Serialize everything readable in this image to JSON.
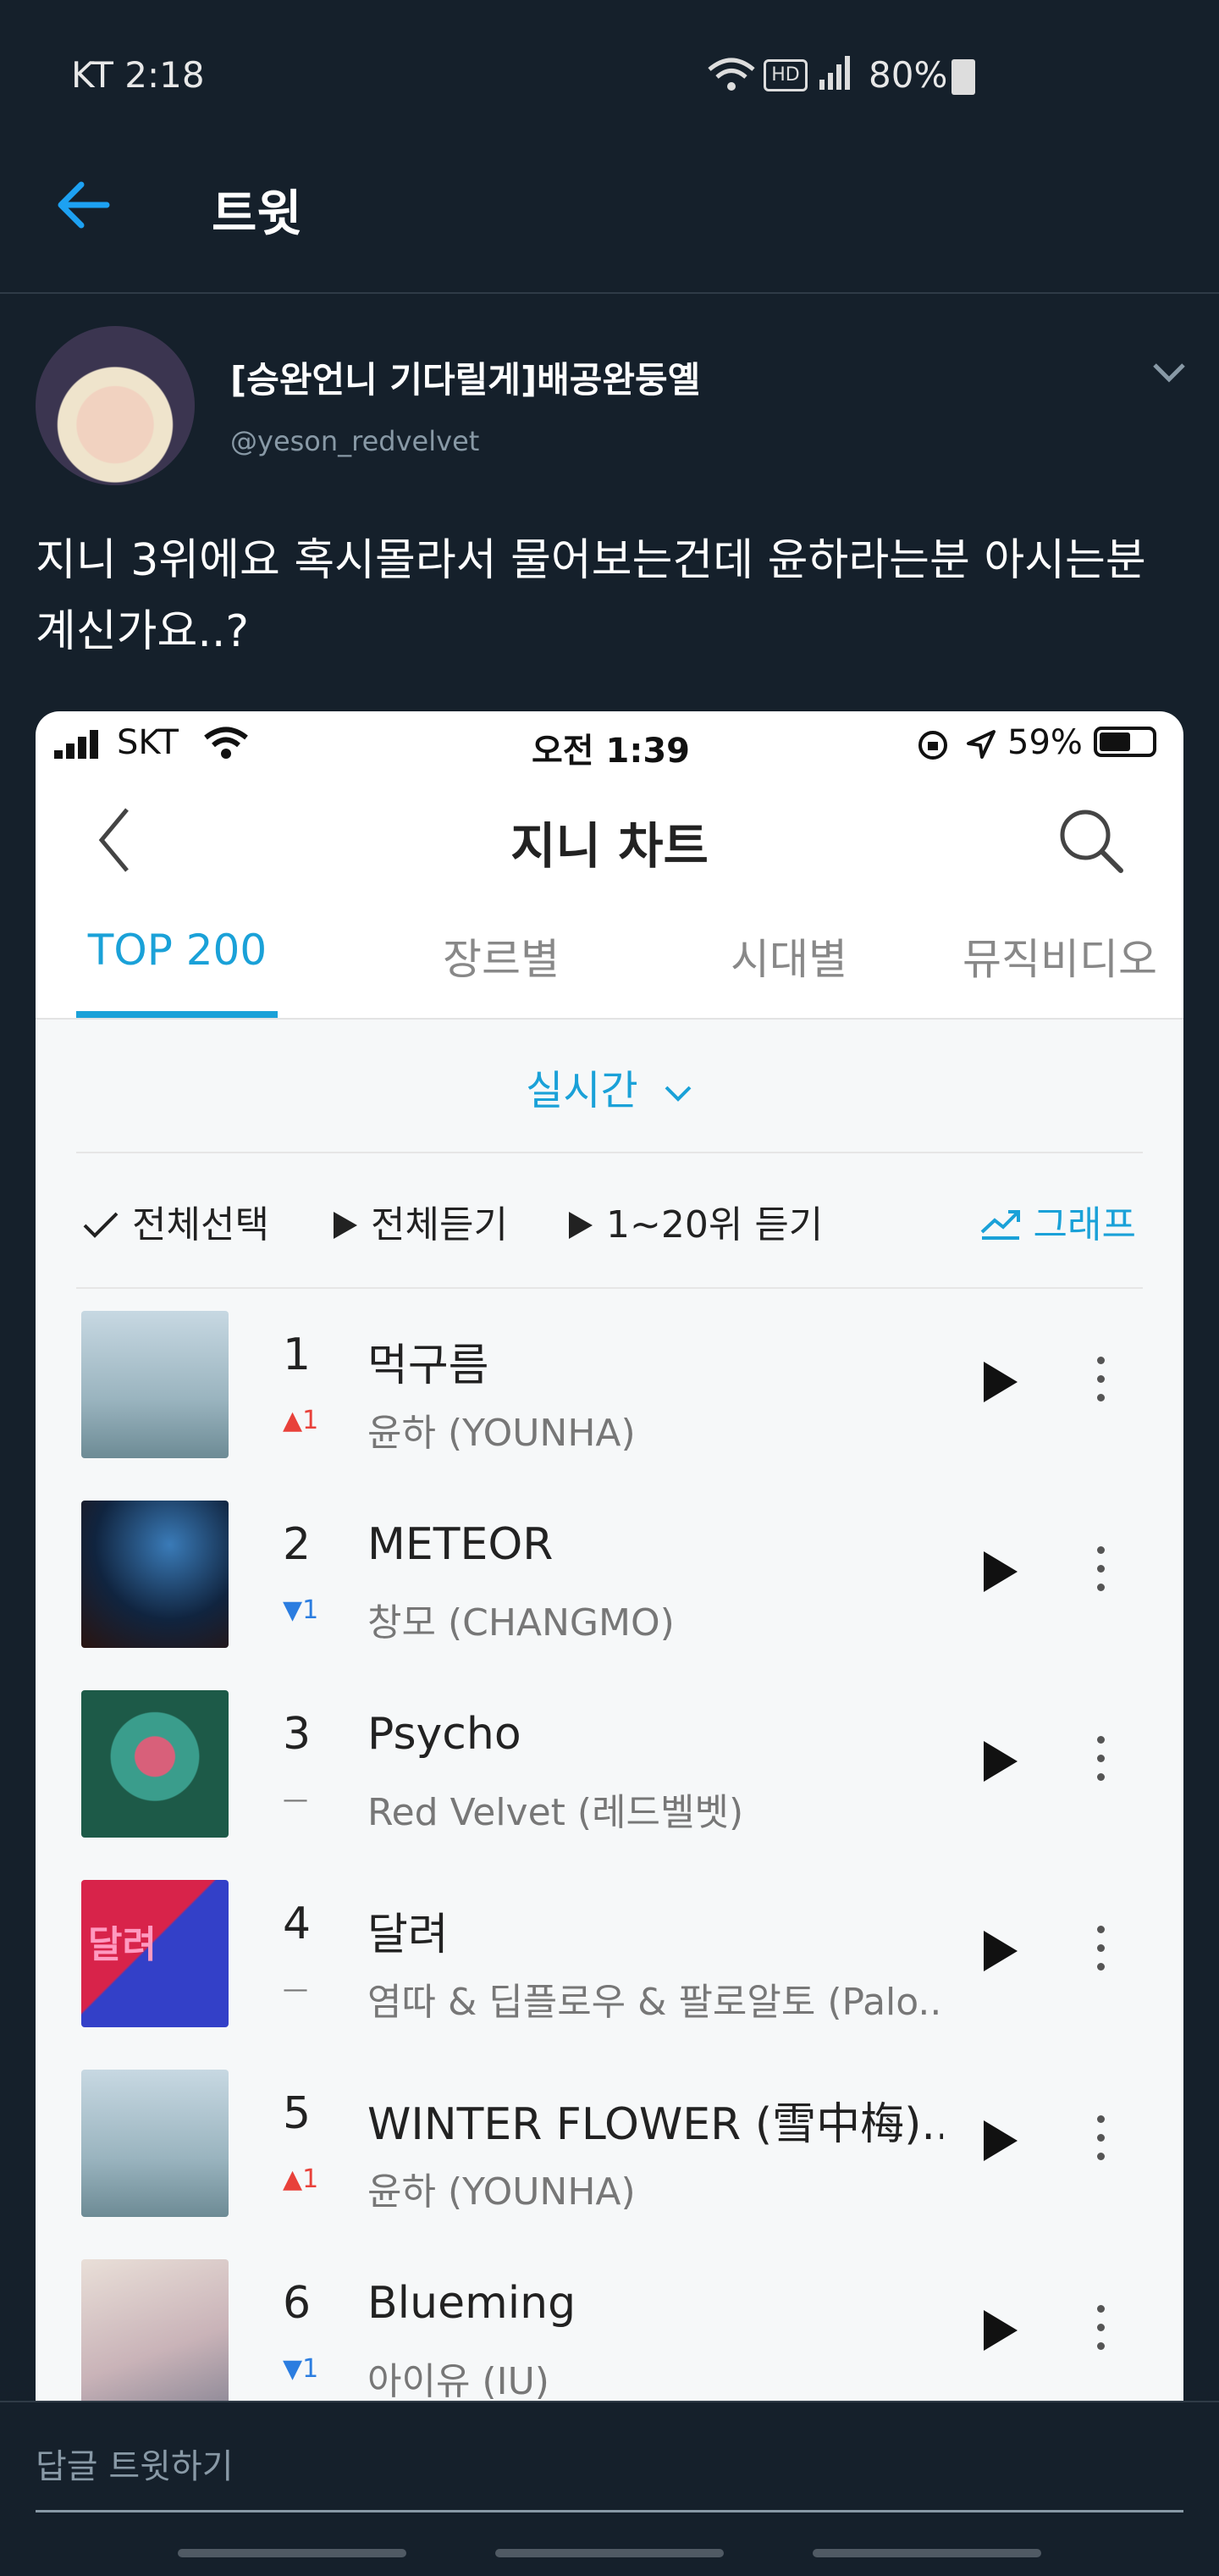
{
  "status_bar": {
    "carrier_time": "KT 2:18",
    "battery": "80%"
  },
  "header": {
    "title": "트윗"
  },
  "tweet": {
    "display_name": "[승완언니 기다릴게]배공완둥옐",
    "handle": "@yeson_redvelvet",
    "text_line1": "지니 3위에요 혹시몰라서 물어보는건데 윤하라는분 아시는분",
    "text_line2": "계신가요..?"
  },
  "embedded": {
    "status": {
      "carrier": "SKT",
      "time": "오전 1:39",
      "battery": "59%"
    },
    "app_title": "지니 차트",
    "tabs": [
      "TOP 200",
      "장르별",
      "시대별",
      "뮤직비디오"
    ],
    "dropdown": "실시간",
    "controls": {
      "select_all": "전체선택",
      "play_all": "전체듣기",
      "play_top20": "1~20위 듣기",
      "graph": "그래프"
    },
    "songs": [
      {
        "rank": "1",
        "change": "▲1",
        "title": "먹구름",
        "artist": "윤하 (YOUNHA)"
      },
      {
        "rank": "2",
        "change": "▼1",
        "title": "METEOR",
        "artist": "창모 (CHANGMO)"
      },
      {
        "rank": "3",
        "change": "—",
        "title": "Psycho",
        "artist": "Red Velvet (레드벨벳)"
      },
      {
        "rank": "4",
        "change": "—",
        "title": "달려",
        "artist": "염따 & 딥플로우 & 팔로알토 (Palo..."
      },
      {
        "rank": "5",
        "change": "▲1",
        "title": "WINTER FLOWER (雪中梅)...",
        "artist": "윤하 (YOUNHA)"
      },
      {
        "rank": "6",
        "change": "▼1",
        "title": "Blueming",
        "artist": "아이유 (IU)"
      }
    ],
    "album4_label": "달려"
  },
  "reply": {
    "placeholder": "답글 트윗하기"
  },
  "colors": {
    "background": "#15202b",
    "accent": "#1da1f2",
    "genie_blue": "#1aa1d8",
    "up": "#e8413a",
    "down": "#2b7de0"
  }
}
